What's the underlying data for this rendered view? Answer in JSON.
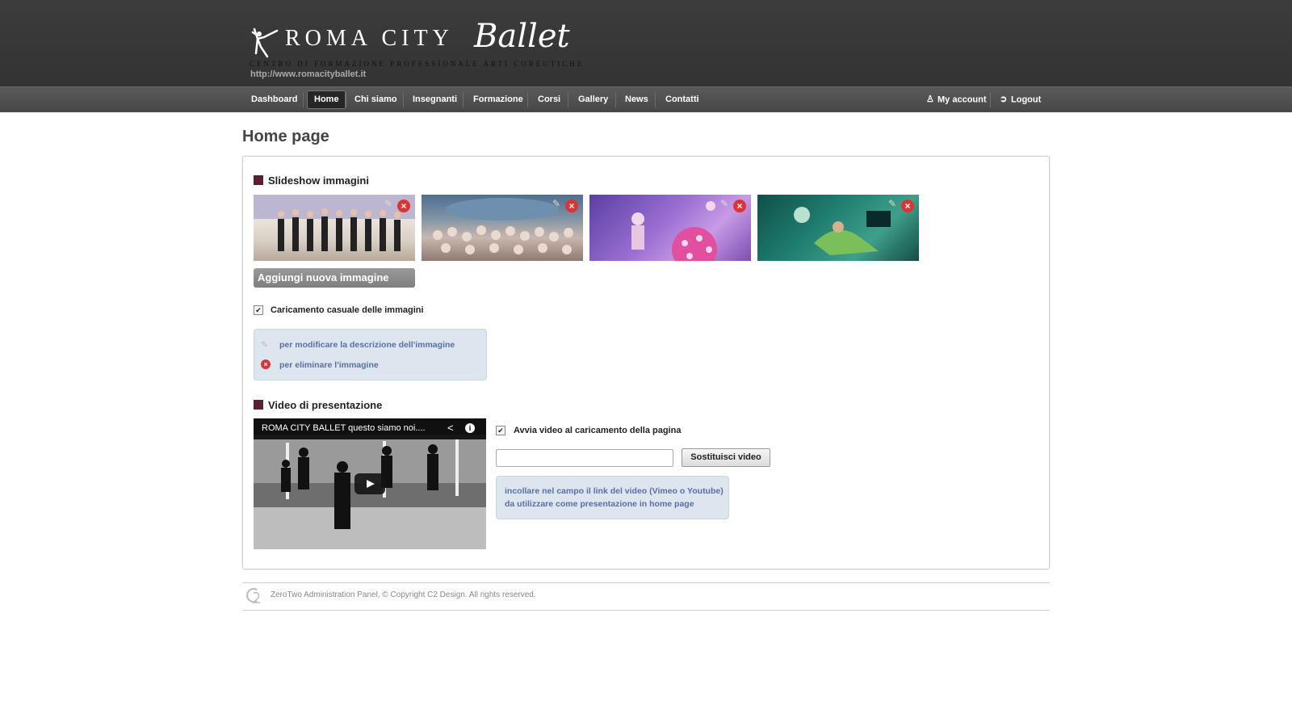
{
  "brand": {
    "name_main": "ROMA CITY",
    "name_script": "Ballet",
    "tagline": "CENTRO DI FORMAZIONE PROFESSIONALE ARTI COREUTICHE",
    "url": "http://www.romacityballet.it"
  },
  "nav": {
    "items": [
      {
        "label": "Dashboard"
      },
      {
        "label": "Home"
      },
      {
        "label": "Chi siamo"
      },
      {
        "label": "Insegnanti"
      },
      {
        "label": "Formazione"
      },
      {
        "label": "Corsi"
      },
      {
        "label": "Gallery"
      },
      {
        "label": "News"
      },
      {
        "label": "Contatti"
      }
    ],
    "active": "Home",
    "my_account": "My account",
    "logout": "Logout"
  },
  "page": {
    "title": "Home page"
  },
  "slideshow": {
    "heading": "Slideshow immagini",
    "add_button": "Aggiungi nuova immagine",
    "random_label": "Caricamento casuale delle immagini",
    "random_checked": true,
    "help_edit": "per modificare la descrizione dell'immagine",
    "help_delete": "per eliminare l'immagine"
  },
  "video": {
    "heading": "Video di presentazione",
    "player_title": "ROMA CITY BALLET questo siamo noi....",
    "autoplay_label": "Avvia video al caricamento della pagina",
    "autoplay_checked": true,
    "url_value": "",
    "replace_button": "Sostituisci video",
    "help_line1": "incollare nel campo il link del video (Vimeo o Youtube)",
    "help_line2": "da utilizzare come presentazione in home page"
  },
  "footer": {
    "text": "ZeroTwo Administration Panel, © Copyright C2 Design.   All rights reserved."
  },
  "colors": {
    "header_bg": "#363636",
    "nav_bg": "#505050",
    "section_square": "#5b1f33",
    "info_box_bg": "#dde5ee",
    "info_text": "#5a6fa5",
    "delete_red": "#dd3333"
  }
}
